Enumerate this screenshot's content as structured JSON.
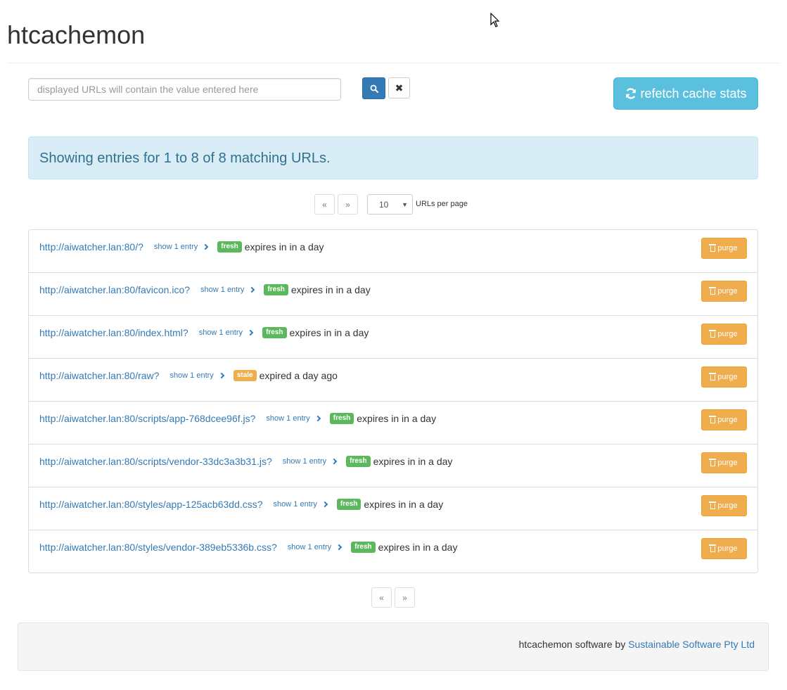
{
  "app": {
    "title": "htcachemon"
  },
  "search": {
    "placeholder": "displayed URLs will contain the value entered here",
    "value": "",
    "search_icon": "search-icon",
    "clear_glyph": "✖"
  },
  "refetch": {
    "label": "refetch cache stats",
    "icon": "refresh-icon"
  },
  "alert": {
    "text": "Showing entries for 1 to 8 of 8 matching URLs."
  },
  "pagination": {
    "prev_label": "«",
    "next_label": "»",
    "per_page_value": "10",
    "per_page_label": "URLs per page"
  },
  "entries": [
    {
      "url": "http://aiwatcher.lan:80/?",
      "show_label": "show 1 entry",
      "status": "fresh",
      "status_text": "expires in in a day",
      "purge_label": "purge"
    },
    {
      "url": "http://aiwatcher.lan:80/favicon.ico?",
      "show_label": "show 1 entry",
      "status": "fresh",
      "status_text": "expires in in a day",
      "purge_label": "purge"
    },
    {
      "url": "http://aiwatcher.lan:80/index.html?",
      "show_label": "show 1 entry",
      "status": "fresh",
      "status_text": "expires in in a day",
      "purge_label": "purge"
    },
    {
      "url": "http://aiwatcher.lan:80/raw?",
      "show_label": "show 1 entry",
      "status": "stale",
      "status_text": "expired a day ago",
      "purge_label": "purge"
    },
    {
      "url": "http://aiwatcher.lan:80/scripts/app-768dcee96f.js?",
      "show_label": "show 1 entry",
      "status": "fresh",
      "status_text": "expires in in a day",
      "purge_label": "purge"
    },
    {
      "url": "http://aiwatcher.lan:80/scripts/vendor-33dc3a3b31.js?",
      "show_label": "show 1 entry",
      "status": "fresh",
      "status_text": "expires in in a day",
      "purge_label": "purge"
    },
    {
      "url": "http://aiwatcher.lan:80/styles/app-125acb63dd.css?",
      "show_label": "show 1 entry",
      "status": "fresh",
      "status_text": "expires in in a day",
      "purge_label": "purge"
    },
    {
      "url": "http://aiwatcher.lan:80/styles/vendor-389eb5336b.css?",
      "show_label": "show 1 entry",
      "status": "fresh",
      "status_text": "expires in in a day",
      "purge_label": "purge"
    }
  ],
  "footer": {
    "text": "htcachemon software by ",
    "link_label": "Sustainable Software Pty Ltd"
  },
  "colors": {
    "primary": "#337ab7",
    "info": "#5bc0de",
    "fresh": "#5cb85c",
    "stale": "#f0ad4e",
    "warning": "#f0ad4e"
  }
}
